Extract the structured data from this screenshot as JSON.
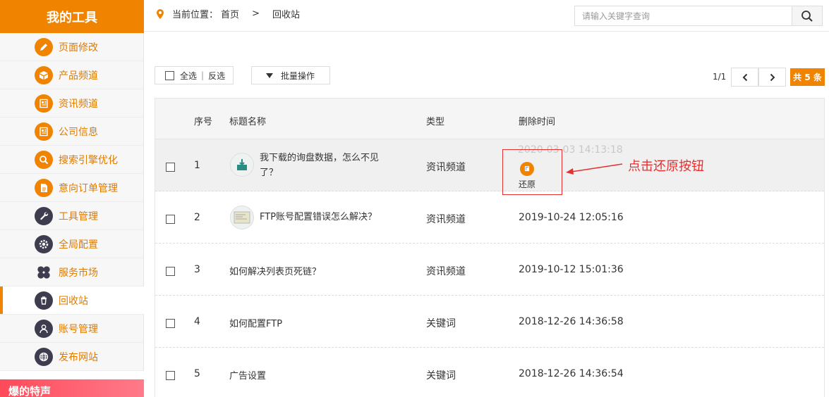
{
  "sidebar": {
    "title": "我的工具",
    "items": [
      {
        "label": "页面修改",
        "icon": "pencil-icon",
        "style": "orange"
      },
      {
        "label": "产品频道",
        "icon": "box-icon",
        "style": "orange"
      },
      {
        "label": "资讯频道",
        "icon": "newspaper-icon",
        "style": "orange"
      },
      {
        "label": "公司信息",
        "icon": "newspaper-icon",
        "style": "orange"
      },
      {
        "label": "搜索引擎优化",
        "icon": "search-icon",
        "style": "orange"
      },
      {
        "label": "意向订单管理",
        "icon": "document-icon",
        "style": "orange"
      },
      {
        "label": "工具管理",
        "icon": "wrench-icon",
        "style": "dark"
      },
      {
        "label": "全局配置",
        "icon": "gear-icon",
        "style": "dark"
      },
      {
        "label": "服务市场",
        "icon": "clover-icon",
        "style": "dark"
      },
      {
        "label": "回收站",
        "icon": "trash-icon",
        "style": "dark",
        "active": true
      },
      {
        "label": "账号管理",
        "icon": "user-icon",
        "style": "dark"
      },
      {
        "label": "发布网站",
        "icon": "globe-icon",
        "style": "dark"
      }
    ],
    "banner_text": "爆的特声"
  },
  "breadcrumb": {
    "prefix": "当前位置：",
    "home": "首页",
    "separator": ">",
    "current": "回收站"
  },
  "search": {
    "placeholder": "请输入关键字查询"
  },
  "toolbar": {
    "select_all": "全选",
    "divider": "|",
    "invert": "反选",
    "batch": "批量操作"
  },
  "pager": {
    "page_text": "1/1",
    "total_text": "共 5 条"
  },
  "table": {
    "headers": {
      "index": "序号",
      "title": "标题名称",
      "type": "类型",
      "deleted_time": "删除时间"
    },
    "rows": [
      {
        "index": "1",
        "title": "我下载的询盘数据，怎么不见了？",
        "type": "资讯频道",
        "time": "2020-03-03 14:13:18",
        "has_thumb": true
      },
      {
        "index": "2",
        "title": "FTP账号配置错误怎么解决？",
        "type": "资讯频道",
        "time": "2019-10-24 12:05:16",
        "has_thumb": true
      },
      {
        "index": "3",
        "title": "如何解决列表页死链？",
        "type": "资讯频道",
        "time": "2019-10-12 15:01:36",
        "has_thumb": false
      },
      {
        "index": "4",
        "title": "如何配置FTP",
        "type": "关键词",
        "time": "2018-12-26 14:36:58",
        "has_thumb": false
      },
      {
        "index": "5",
        "title": "广告设置",
        "type": "关键词",
        "time": "2018-12-26 14:36:54",
        "has_thumb": false
      }
    ],
    "restore_label": "还原"
  },
  "annotation": {
    "text": "点击还原按钮",
    "color": "#e53030"
  },
  "colors": {
    "accent": "#f08300",
    "dark_icon": "#3d3d4f"
  }
}
